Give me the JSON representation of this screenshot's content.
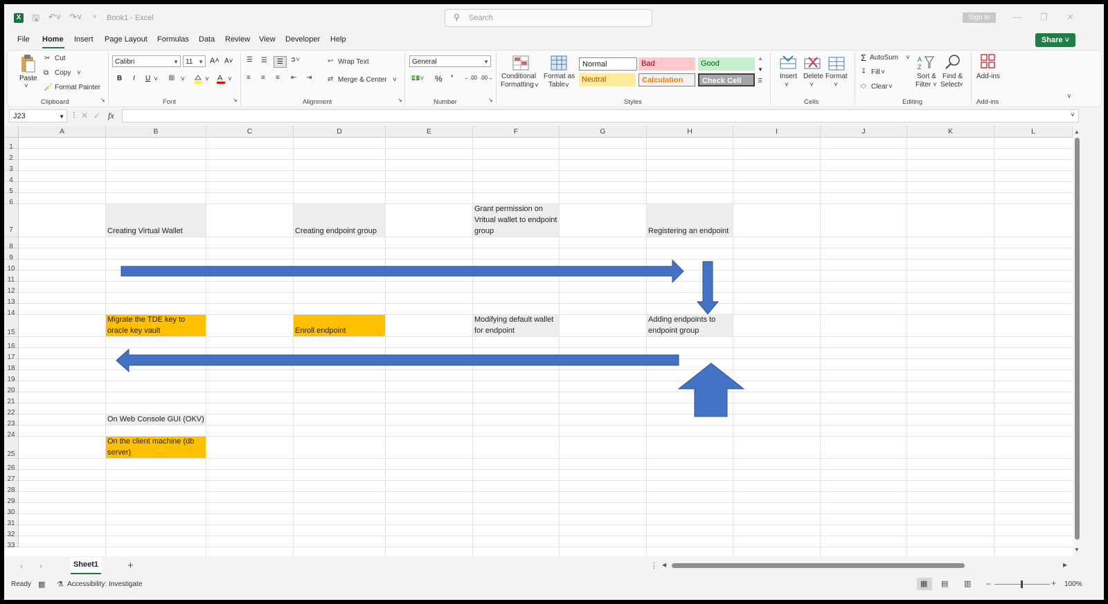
{
  "titlebar": {
    "logo": "X",
    "doc_title": "Book1  -  Excel",
    "search_placeholder": "Search",
    "sign_in": "Sign in"
  },
  "menu": {
    "items": [
      "File",
      "Home",
      "Insert",
      "Page Layout",
      "Formulas",
      "Data",
      "Review",
      "View",
      "Developer",
      "Help"
    ],
    "active": "Home",
    "share_label": "Share"
  },
  "ribbon": {
    "clipboard": {
      "label": "Clipboard",
      "paste": "Paste",
      "cut": "Cut",
      "copy": "Copy",
      "format_painter": "Format Painter"
    },
    "font": {
      "label": "Font",
      "font_name": "Calibri",
      "font_size": "11",
      "bold": "B",
      "italic": "I",
      "underline": "U"
    },
    "alignment": {
      "label": "Alignment",
      "wrap_text": "Wrap Text",
      "merge_center": "Merge & Center"
    },
    "number": {
      "label": "Number",
      "format": "General"
    },
    "styles": {
      "label": "Styles",
      "conditional_formatting": [
        "Conditional",
        "Formatting"
      ],
      "format_as_table": [
        "Format as",
        "Table"
      ],
      "normal": "Normal",
      "bad": "Bad",
      "good": "Good",
      "neutral": "Neutral",
      "calculation": "Calculation",
      "check_cell": "Check Cell"
    },
    "cells": {
      "label": "Cells",
      "insert": "Insert",
      "delete": "Delete",
      "format": "Format"
    },
    "editing": {
      "label": "Editing",
      "autosum": "AutoSum",
      "fill": "Fill",
      "clear": "Clear",
      "sort_filter": [
        "Sort &",
        "Filter"
      ],
      "find_select": [
        "Find &",
        "Select"
      ]
    },
    "addins": {
      "label": "Add-ins",
      "addins": "Add-ins"
    }
  },
  "formula_bar": {
    "name_box": "J23",
    "fx": "fx",
    "value": ""
  },
  "grid": {
    "columns": [
      "A",
      "B",
      "C",
      "D",
      "E",
      "F",
      "G",
      "H",
      "I",
      "J",
      "K",
      "L"
    ],
    "rows": [
      "1",
      "2",
      "3",
      "4",
      "5",
      "6",
      "7",
      "8",
      "9",
      "10",
      "11",
      "12",
      "13",
      "14",
      "15",
      "16",
      "17",
      "18",
      "19",
      "20",
      "21",
      "22",
      "23",
      "24",
      "25",
      "26",
      "27",
      "28",
      "29",
      "30",
      "31",
      "32",
      "33"
    ],
    "cells": {
      "B7": "Creating Virtual Wallet",
      "D7": "Creating endpoint group",
      "F7": "Grant permission on Vritual wallet to endpoint group",
      "H7": "Registering an endpoint",
      "B15": "Migrate the TDE key to oracle key vault",
      "D15": "Enroll endpoint",
      "F15": "Modifying default wallet for endpoint",
      "H15": "Adding endpoints to endpoint group",
      "B23": "On Web Console GUI (OKV)",
      "B25": "On the client machine (db server)"
    },
    "colors": {
      "gray": "#ededed",
      "orange": "#ffc000",
      "arrow": "#4472c4"
    }
  },
  "sheets": {
    "tabs": [
      "Sheet1"
    ],
    "active": "Sheet1"
  },
  "status": {
    "ready": "Ready",
    "accessibility": "Accessibility: Investigate",
    "zoom": "100%"
  }
}
